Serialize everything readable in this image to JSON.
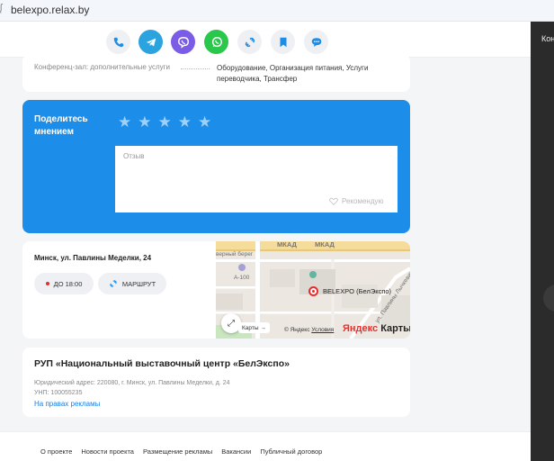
{
  "browser": {
    "url": "belexpo.relax.by"
  },
  "contact_bar": {
    "buttons": [
      {
        "name": "phone-icon",
        "bg": "#eef0f3",
        "fg": "#1c8de8"
      },
      {
        "name": "telegram-icon",
        "bg": "#2aa3df",
        "fg": "#ffffff"
      },
      {
        "name": "viber-icon",
        "bg": "#7b5ce6",
        "fg": "#ffffff"
      },
      {
        "name": "whatsapp-icon",
        "bg": "#2ac74c",
        "fg": "#ffffff"
      },
      {
        "name": "link-icon",
        "bg": "#eef0f3",
        "fg": "#1c8de8"
      },
      {
        "name": "bookmark-icon",
        "bg": "#eef0f3",
        "fg": "#1c8de8"
      },
      {
        "name": "chat-icon",
        "bg": "#eef0f3",
        "fg": "#1c8de8"
      }
    ]
  },
  "services": {
    "label": "Конференц-зал: дополнительные услуги",
    "value": "Оборудование, Организация питания, Услуги переводчика, Трансфер"
  },
  "review": {
    "title": "Поделитесь мнением",
    "stars": [
      "★",
      "★",
      "★",
      "★",
      "★"
    ],
    "rating": 0,
    "placeholder": "Отзыв",
    "recommend": "Рекомендую",
    "bg_color": "#1c8de8"
  },
  "location": {
    "address": "Минск, ул. Павлины Меделки, 24",
    "hours": "ДО 18:00",
    "route": "МАРШРУТ",
    "map": {
      "labels": [
        "МКАД",
        "МКАД",
        "верный берег",
        "А-100",
        "ул. Павлины Лычкевича"
      ],
      "place": "BELEXPO (БелЭкспо)",
      "to_maps": "Карты →",
      "copyright": "© Яндекс",
      "terms": "Условия",
      "logo_a": "Яндекс",
      "logo_b": "Карты"
    }
  },
  "organization": {
    "name": "РУП «Национальный выставочный центр «БелЭкспо»",
    "legal_address": "Юридический адрес: 220080, г. Минск, ул. Павлины Меделки, д. 24",
    "unp": "УНП: 100055235",
    "ad": "На правах рекламы"
  },
  "right_panel": {
    "text": "Конф"
  },
  "footer": {
    "links": [
      "О проекте",
      "Новости проекта",
      "Размещение рекламы",
      "Вакансии",
      "Публичный договор"
    ]
  }
}
